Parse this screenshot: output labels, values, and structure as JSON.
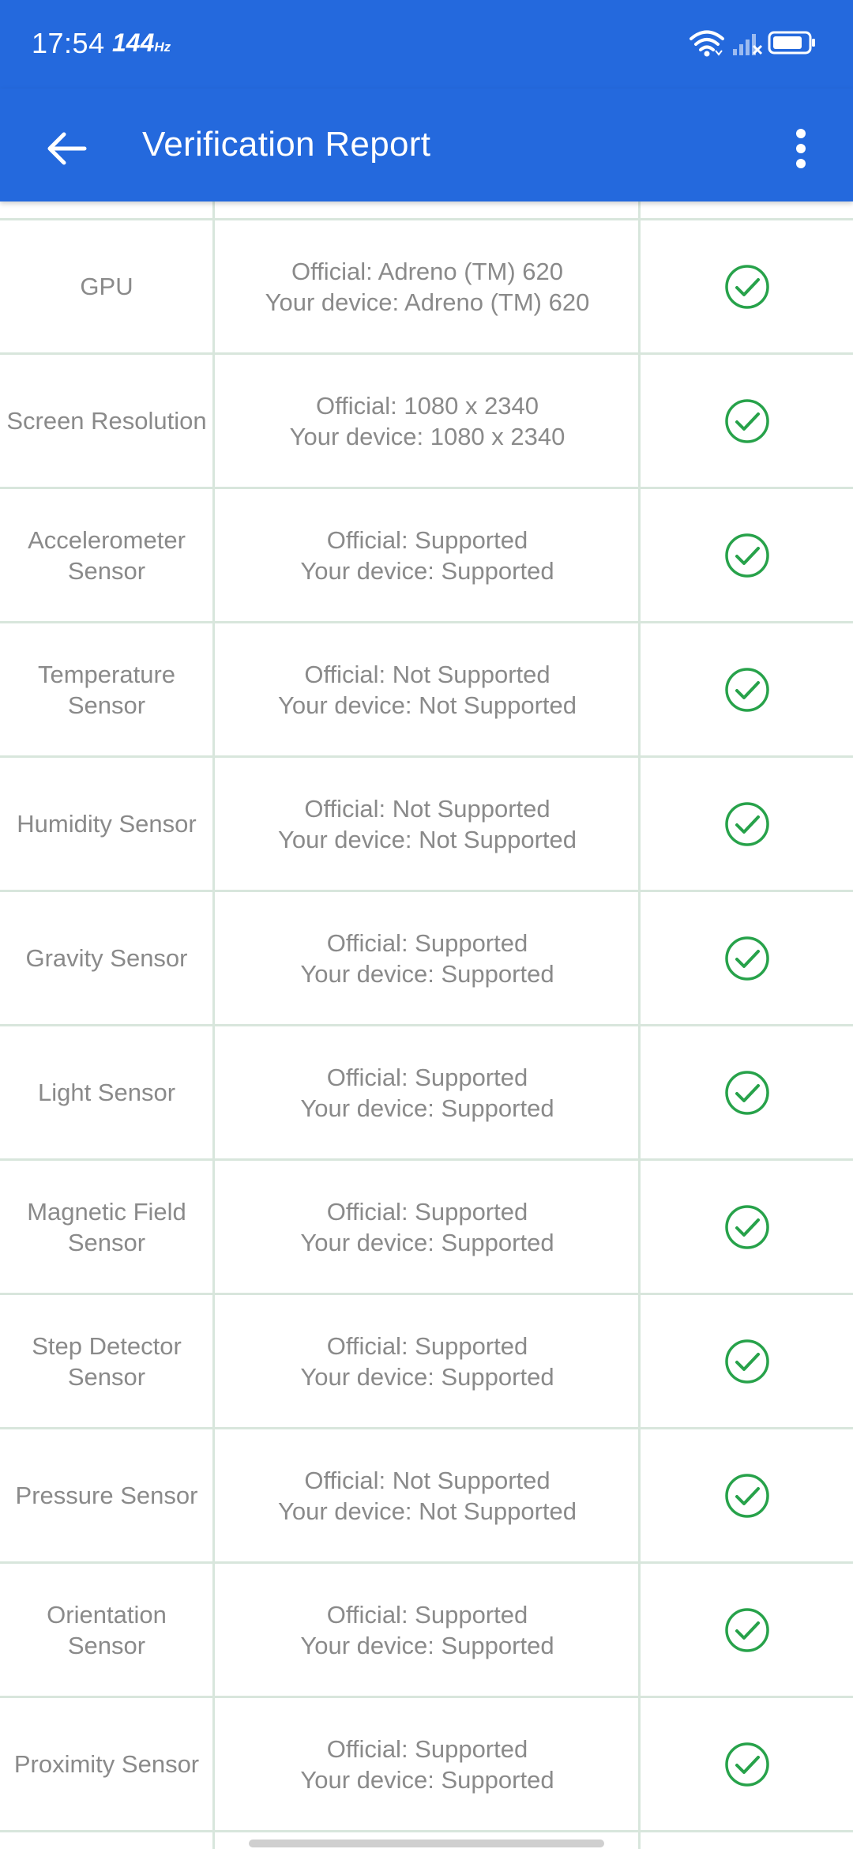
{
  "status_bar": {
    "time": "17:54",
    "refresh_rate": "144",
    "refresh_unit": "Hz"
  },
  "app_bar": {
    "title": "Verification Report",
    "back_icon": "arrow-left-icon",
    "more_icon": "more-vert-icon"
  },
  "colors": {
    "primary": "#2469dd",
    "check": "#27a24a",
    "text": "#8a8a8a",
    "grid": "#d8e6dc"
  },
  "rows": [
    {
      "name": "GPU",
      "official": "Official: Adreno (TM) 620",
      "device": "Your device: Adreno (TM) 620",
      "status_icon": "check-circle-icon"
    },
    {
      "name": "Screen Resolution",
      "official": "Official: 1080 x 2340",
      "device": "Your device: 1080 x 2340",
      "status_icon": "check-circle-icon"
    },
    {
      "name": "Accelerometer\nSensor",
      "official": "Official: Supported",
      "device": "Your device: Supported",
      "status_icon": "check-circle-icon"
    },
    {
      "name": "Temperature\nSensor",
      "official": "Official: Not Supported",
      "device": "Your device: Not Supported",
      "status_icon": "check-circle-icon"
    },
    {
      "name": "Humidity Sensor",
      "official": "Official: Not Supported",
      "device": "Your device: Not Supported",
      "status_icon": "check-circle-icon"
    },
    {
      "name": "Gravity Sensor",
      "official": "Official: Supported",
      "device": "Your device: Supported",
      "status_icon": "check-circle-icon"
    },
    {
      "name": "Light Sensor",
      "official": "Official: Supported",
      "device": "Your device: Supported",
      "status_icon": "check-circle-icon"
    },
    {
      "name": "Magnetic Field\nSensor",
      "official": "Official: Supported",
      "device": "Your device: Supported",
      "status_icon": "check-circle-icon"
    },
    {
      "name": "Step Detector\nSensor",
      "official": "Official: Supported",
      "device": "Your device: Supported",
      "status_icon": "check-circle-icon"
    },
    {
      "name": "Pressure Sensor",
      "official": "Official: Not Supported",
      "device": "Your device: Not Supported",
      "status_icon": "check-circle-icon"
    },
    {
      "name": "Orientation\nSensor",
      "official": "Official: Supported",
      "device": "Your device: Supported",
      "status_icon": "check-circle-icon"
    },
    {
      "name": "Proximity Sensor",
      "official": "Official: Supported",
      "device": "Your device: Supported",
      "status_icon": "check-circle-icon"
    }
  ]
}
